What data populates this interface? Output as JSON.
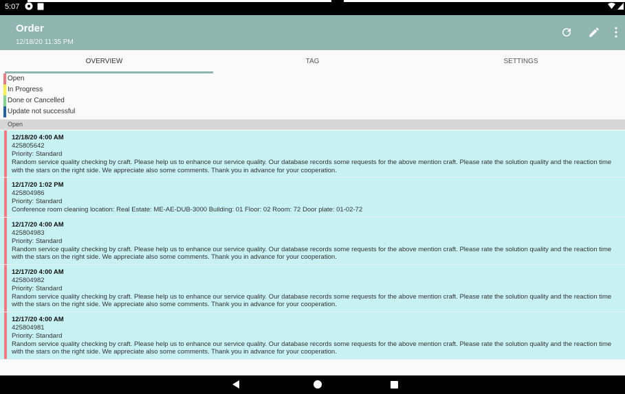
{
  "status": {
    "time": "5:07"
  },
  "header": {
    "title": "Order",
    "subtitle": "12/18/20 11:35 PM"
  },
  "actions": [
    "refresh-icon",
    "edit-icon",
    "more-icon"
  ],
  "tabs": [
    {
      "label": "OVERVIEW",
      "active": true
    },
    {
      "label": "TAG"
    },
    {
      "label": "SETTINGS"
    }
  ],
  "legend": [
    {
      "label": "Open",
      "color": "#ef7a80"
    },
    {
      "label": "In Progress",
      "color": "#f7ef42"
    },
    {
      "label": "Done or Cancelled",
      "color": "#7fd68a"
    },
    {
      "label": "Update not successful",
      "color": "#1e62b0"
    }
  ],
  "section": {
    "label": "Open"
  },
  "orders": [
    {
      "when": "12/18/20 4:00 AM",
      "number": "425805642",
      "priority": "Priority: Standard",
      "desc": "Random service quality checking by craft. Please help us to enhance our service quality. Our database records some requests for the above mention craft. Please rate the solution quality and the reaction time with the stars on the right side. We appreciate also some comments. Thank you in advance for your cooperation."
    },
    {
      "when": "12/17/20 1:02 PM",
      "number": "425804986",
      "priority": "Priority: Standard",
      "desc": "Conference room cleaning location: Real Estate: ME-AE-DUB-3000 Building: 01 Floor: 02 Room: 72 Door plate: 01-02-72"
    },
    {
      "when": "12/17/20 4:00 AM",
      "number": "425804983",
      "priority": "Priority: Standard",
      "desc": "Random service quality checking by craft. Please help us to enhance our service quality. Our database records some requests for the above mention craft. Please rate the solution quality and the reaction time with the stars on the right side. We appreciate also some comments. Thank you in advance for your cooperation."
    },
    {
      "when": "12/17/20 4:00 AM",
      "number": "425804982",
      "priority": "Priority: Standard",
      "desc": "Random service quality checking by craft. Please help us to enhance our service quality. Our database records some requests for the above mention craft. Please rate the solution quality and the reaction time with the stars on the right side. We appreciate also some comments. Thank you in advance for your cooperation."
    },
    {
      "when": "12/17/20 4:00 AM",
      "number": "425804981",
      "priority": "Priority: Standard",
      "desc": "Random service quality checking by craft. Please help us to enhance our service quality. Our database records some requests for the above mention craft. Please rate the solution quality and the reaction time with the stars on the right side. We appreciate also some comments. Thank you in advance for your cooperation."
    }
  ]
}
